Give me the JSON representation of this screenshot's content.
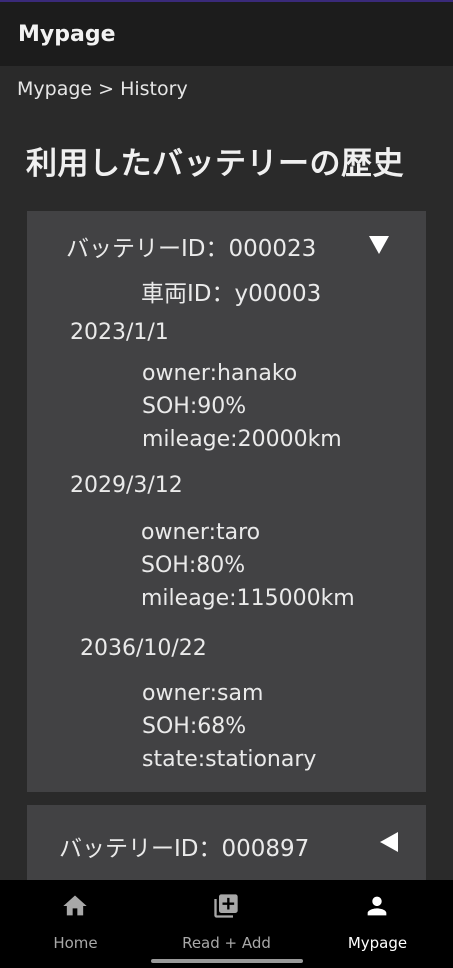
{
  "appbar": {
    "title": "Mypage"
  },
  "breadcrumb": "Mypage > History",
  "page_title": "利用したバッテリーの歴史",
  "batteries": [
    {
      "id_label": "バッテリーID：000023",
      "vehicle_label": "車両ID：y00003",
      "expanded": true,
      "history": [
        {
          "date": "2023/1/1",
          "lines": [
            "owner:hanako",
            "SOH:90%",
            "mileage:20000km"
          ]
        },
        {
          "date": "2029/3/12",
          "lines": [
            "owner:taro",
            "SOH:80%",
            "mileage:115000km"
          ]
        },
        {
          "date": "2036/10/22",
          "lines": [
            "owner:sam",
            "SOH:68%",
            "state:stationary"
          ]
        }
      ]
    },
    {
      "id_label": "バッテリーID：000897",
      "expanded": false
    }
  ],
  "bottom_nav": [
    {
      "label": "Home",
      "icon": "home-icon",
      "active": false
    },
    {
      "label": "Read + Add",
      "icon": "library-add-icon",
      "active": false
    },
    {
      "label": "Mypage",
      "icon": "person-icon",
      "active": true
    }
  ],
  "colors": {
    "background": "#2a2a2a",
    "appbar": "#1c1c1c",
    "card": "#424244",
    "nav_background": "#000000",
    "nav_active": "#ffffff",
    "nav_inactive": "#a8a8a8"
  }
}
